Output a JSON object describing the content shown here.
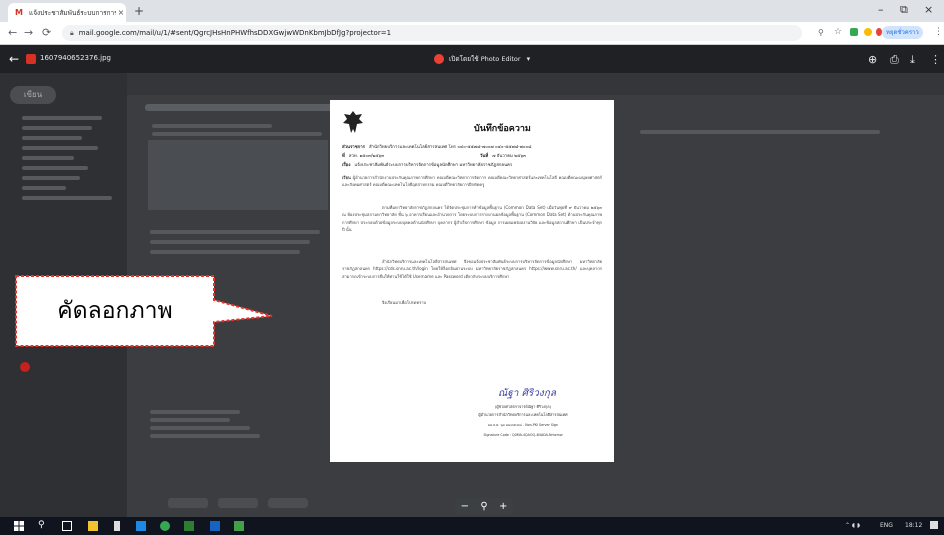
{
  "browser": {
    "tab_title": "แจ้งประชาสัมพันธ์ระบบการการบริหาร",
    "tab_close": "×",
    "new_tab": "+",
    "url": "mail.google.com/mail/u/1/#sent/QgrcJHsHnPHWfhsDDXGwjwWDnKbmJbDfJg?projector=1",
    "profile_label": "หยุดชั่วคราว",
    "window_minimize": "–",
    "window_restore": "⧉",
    "window_close": "×"
  },
  "viewer": {
    "filename": "1607940652376.jpg",
    "open_with": "เปิดโดยใช้ Photo Editor",
    "back_icon": "arrow-left-icon",
    "zoom_minus": "−",
    "zoom_search": "⚲",
    "zoom_plus": "+"
  },
  "gmail": {
    "compose_label": "เขียน"
  },
  "document": {
    "title": "บันทึกข้อความ",
    "dept_label": "ส่วนราชการ",
    "dept_value": "สำนักวิทยบริการและเทคโนโลยีสารสนเทศ โทร ๐๔๐-๕๕๗๘-๗๐๐๗ ๐๔๐-๕๕๗๘-๗๐๐๘",
    "ref_label": "ที่",
    "ref_value": "สวท. ๑๕๐๓/๒๕๖๓",
    "date_label": "วันที่",
    "date_value": "๗ ธันวาคม ๒๕๖๓",
    "subject_label": "เรื่อง",
    "subject_value": "แจ้งประชาสัมพันธ์ระบบการบริหารจัดการข้อมูลนักศึกษา มหาวิทยาลัยราชภัฏสกลนคร",
    "to_label": "เรียน",
    "to_value": "ผู้อำนวยการสำนักงานประกันคุณภาพการศึกษา คณบดีคณะวิทยาการจัดการ คณบดีคณะวิทยาศาสตร์และเทคโนโลยี คณบดีคณะมนุษยศาสตร์และสังคมศาสตร์ คณบดีคณะเทคโนโลยีอุตสาหกรรม คณบดีวิทยาลัยการฝึกหัดครู",
    "para1": "ตามที่มหาวิทยาลัยราชภัฏสกลนคร ได้จัดประชุมการทำข้อมูลพื้นฐาน (Common Data Set) เมื่อวันพุธที่ ๙ ธันวาคม ๒๕๖๓ ณ ห้องประชุมสภามหาวิทยาลัย ชั้น ๖ อาคารเรียนและอำนวยการ โดยระบบการรายงานผลข้อมูลพื้นฐาน (Common Data Set) ด้านประกันคุณภาพการศึกษา ประกอบด้วยข้อมูลระบบบุคคลด้านนักศึกษา บุคลากร ผู้สำเร็จการศึกษา ข้อมูล การเผยแพร่ผลงานวิจัย และข้อมูลสถานศึกษา เป็นประจำทุกปี นั้น",
    "para2": "สำนักวิทยบริการและเทคโนโลยีสารสนเทศ จึงขอแจ้งประชาสัมพันธ์ระบบการบริหารจัดการข้อมูลนักศึกษา มหาวิทยาลัยราชภัฏสกลนคร https://cds.snru.ac.th/login โดยให้ล็อกอินผ่านระบบ มหาวิทยาลัยราชภัฏสกลนคร https://www.snru.ac.th/ และบุคลากรสามารถเข้าระบบการยื่นให้ท่านใช้ได้ใช้ Username และ Password เดียวกับระบบบริการศึกษา",
    "closing": "จึงเรียนมาเพื่อโปรดทราบ",
    "signature": "ณัฐา ศิริวงกุล",
    "signer_name": "(ผู้ช่วยศาสตราจารย์ณัฐา ศิริวงกุล)",
    "signer_title": "ผู้อำนวยการสำนักวิทยบริการและเทคโนโลยีสารสนเทศ",
    "signed_note": "๑๑ ธ.ค. ๖๓ ๑๑:๓๕:๓๘ - Non-PKI Server Sign",
    "signature_code": "Signature Code : Q0MA-4QAOQ-4NADA-Nmxmw"
  },
  "callout": {
    "text": "คัดลอกภาพ"
  },
  "taskbar": {
    "lang": "ENG",
    "time": "18:12"
  },
  "colors": {
    "viewer_bg": "#202124",
    "callout_stroke": "#e8312a",
    "gmail_red": "#d93025"
  }
}
